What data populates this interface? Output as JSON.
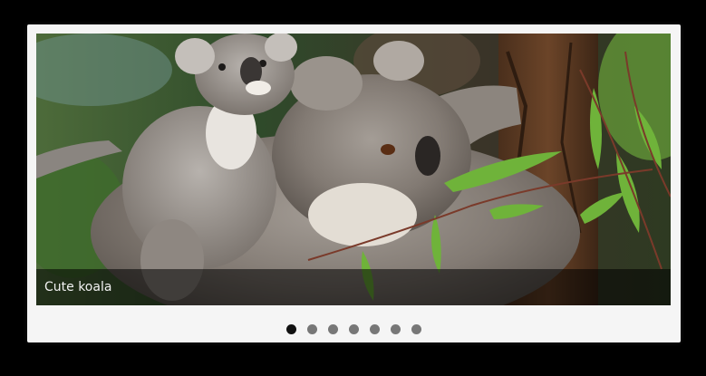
{
  "slider": {
    "caption": "Cute koala",
    "active_index": 0,
    "slide_count": 7,
    "slide_image": "koala-with-baby-photo"
  },
  "colors": {
    "page_background": "#000000",
    "frame_background": "#f5f5f5",
    "dot_active": "#111111",
    "dot_inactive": "#777777"
  }
}
